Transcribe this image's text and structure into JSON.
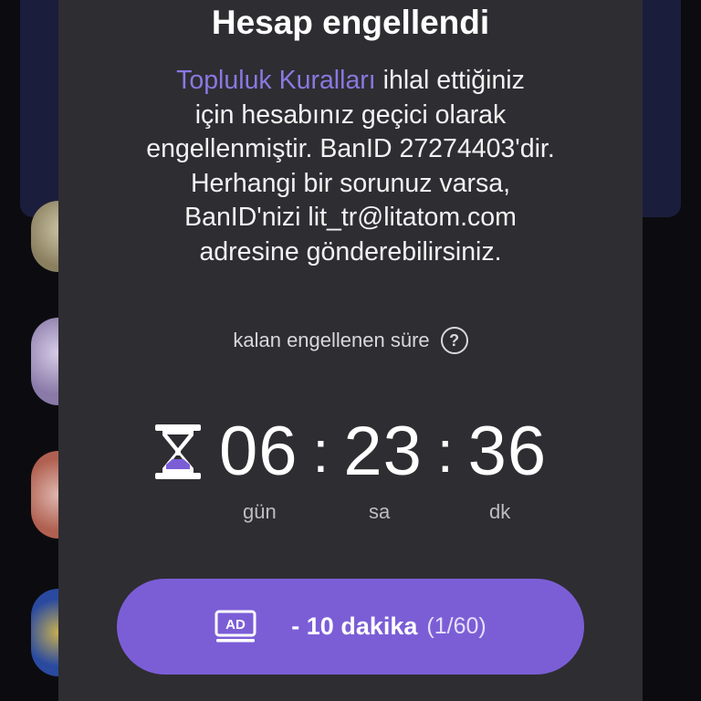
{
  "dialog": {
    "title": "Hesap engellendi",
    "message_link": "Topluluk Kuralları",
    "message_line1_rest": " ihlal ettiğiniz",
    "message_line2": "için hesabınız geçici olarak",
    "message_line3": "engellenmiştir. BanID 27274403'dir.",
    "message_line4": "Herhangi bir sorunuz varsa,",
    "message_line5": "BanID'nizi lit_tr@litatom.com",
    "message_line6": "adresine gönderebilirsiniz.",
    "remaining_label": "kalan engellenen süre",
    "help_icon": "?",
    "timer": {
      "days": "06",
      "hours": "23",
      "minutes": "36",
      "separator": ":",
      "unit_days": "gün",
      "unit_hours": "sa",
      "unit_minutes": "dk"
    },
    "ad_button": {
      "icon_text": "AD",
      "label": "- 10 dakika",
      "count": "(1/60)"
    }
  },
  "colors": {
    "dialog_bg": "#2e2d32",
    "accent": "#7b5ed6",
    "link": "#8a78e0",
    "backdrop_card": "#1b1d3c"
  },
  "icons": {
    "hourglass": "hourglass-icon",
    "help": "question-circle-icon",
    "ad": "ad-screen-icon"
  }
}
